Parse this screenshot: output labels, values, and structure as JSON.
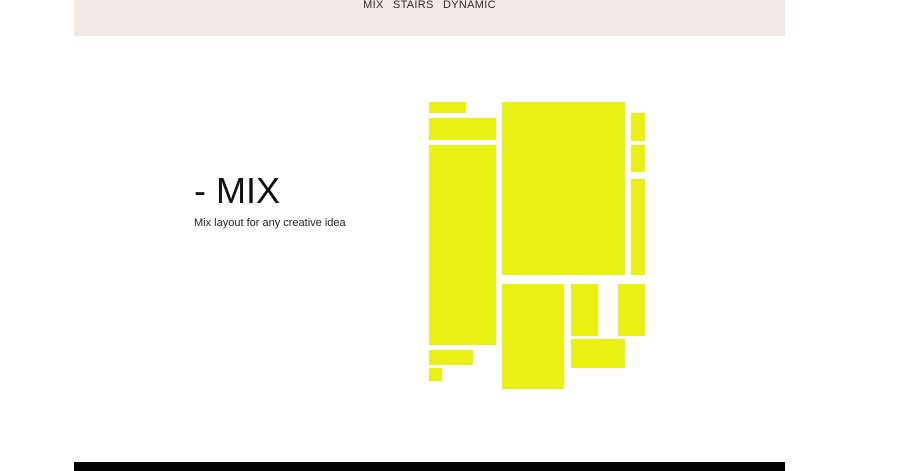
{
  "nav": {
    "items": [
      {
        "label": "MIX"
      },
      {
        "label": "STAIRS"
      },
      {
        "label": "DYNAMIC"
      }
    ]
  },
  "hero": {
    "title": "- MIX",
    "subtitle": "Mix layout for any creative idea"
  },
  "colors": {
    "accent": "#e9f014",
    "header_bg": "#f2e9e7",
    "footer_bg": "#000000"
  }
}
